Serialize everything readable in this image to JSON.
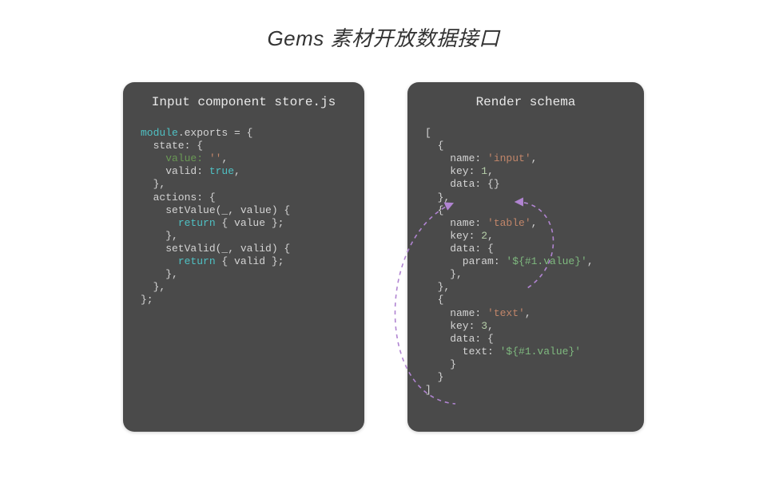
{
  "title": "Gems 素材开放数据接口",
  "left": {
    "heading": "Input component store.js",
    "code_tokens": [
      [
        "kw",
        "module"
      ],
      [
        "",
        ".exports = {\n"
      ],
      [
        "",
        "  state: {\n"
      ],
      [
        "",
        "    "
      ],
      [
        "green",
        "value:"
      ],
      [
        "",
        " "
      ],
      [
        "str",
        "''"
      ],
      [
        "",
        ",\n"
      ],
      [
        "",
        "    valid: "
      ],
      [
        "kw",
        "true"
      ],
      [
        "",
        ",\n"
      ],
      [
        "",
        "  },\n"
      ],
      [
        "",
        "  actions: {\n"
      ],
      [
        "",
        "    setValue(_, value) {\n"
      ],
      [
        "",
        "      "
      ],
      [
        "kw",
        "return"
      ],
      [
        "",
        " { value };\n"
      ],
      [
        "",
        "    },\n"
      ],
      [
        "",
        "    setValid(_, valid) {\n"
      ],
      [
        "",
        "      "
      ],
      [
        "kw",
        "return"
      ],
      [
        "",
        " { valid };\n"
      ],
      [
        "",
        "    },\n"
      ],
      [
        "",
        "  },\n"
      ],
      [
        "",
        "};"
      ]
    ]
  },
  "right": {
    "heading": "Render schema",
    "code_tokens": [
      [
        "",
        "[\n"
      ],
      [
        "",
        "  {\n"
      ],
      [
        "",
        "    name: "
      ],
      [
        "str",
        "'input'"
      ],
      [
        "",
        ",\n"
      ],
      [
        "",
        "    key: "
      ],
      [
        "num",
        "1"
      ],
      [
        "",
        ",\n"
      ],
      [
        "",
        "    data: {}\n"
      ],
      [
        "",
        "  },\n"
      ],
      [
        "",
        "  {\n"
      ],
      [
        "",
        "    name: "
      ],
      [
        "str",
        "'table'"
      ],
      [
        "",
        ",\n"
      ],
      [
        "",
        "    key: "
      ],
      [
        "num",
        "2"
      ],
      [
        "",
        ",\n"
      ],
      [
        "",
        "    data: {\n"
      ],
      [
        "",
        "      param: "
      ],
      [
        "tmpl",
        "'${#1.value}'"
      ],
      [
        "",
        ",\n"
      ],
      [
        "",
        "    },\n"
      ],
      [
        "",
        "  },\n"
      ],
      [
        "",
        "  {\n"
      ],
      [
        "",
        "    name: "
      ],
      [
        "str",
        "'text'"
      ],
      [
        "",
        ",\n"
      ],
      [
        "",
        "    key: "
      ],
      [
        "num",
        "3"
      ],
      [
        "",
        ",\n"
      ],
      [
        "",
        "    data: {\n"
      ],
      [
        "",
        "      text: "
      ],
      [
        "tmpl",
        "'${#1.value}'"
      ],
      [
        "",
        "\n"
      ],
      [
        "",
        "    }\n"
      ],
      [
        "",
        "  }\n"
      ],
      [
        "",
        "]"
      ]
    ]
  },
  "arrows": {
    "color": "#b084d1"
  }
}
